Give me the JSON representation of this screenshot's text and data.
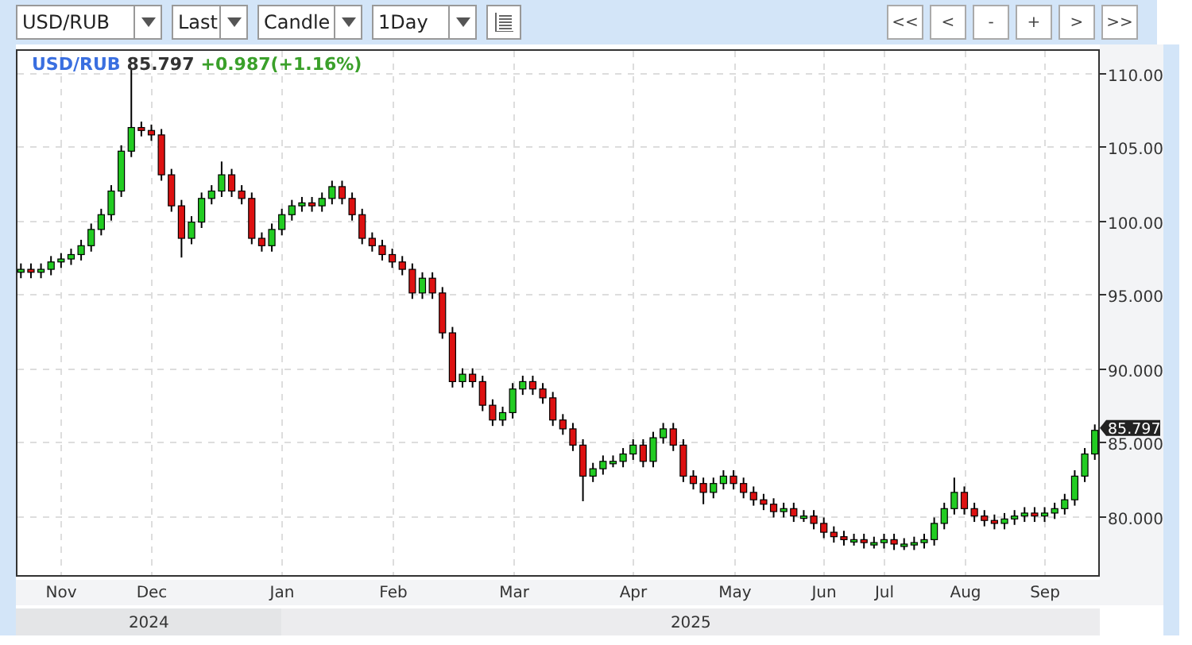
{
  "toolbar": {
    "selects": [
      {
        "value": "USD/RUB",
        "kind": "wide"
      },
      {
        "value": "Last",
        "kind": "narrow"
      },
      {
        "value": "Candle",
        "kind": "medium"
      },
      {
        "value": "1Day",
        "kind": "medium"
      }
    ],
    "nav_buttons": [
      "<<",
      "<",
      "-",
      "+",
      ">",
      ">>"
    ]
  },
  "legend": {
    "price": "85.797",
    "change": "+0.987(+1.16%)"
  },
  "chart": {
    "chart_data": {
      "type": "candlestick",
      "grid": true,
      "series": [
        {
          "name": "USD/RUB",
          "ohlc": [
            [
              96.5,
              97.1,
              96.1,
              96.7
            ],
            [
              96.7,
              97.1,
              96.1,
              96.5
            ],
            [
              96.5,
              97.1,
              96.1,
              96.7
            ],
            [
              96.7,
              97.6,
              96.3,
              97.2
            ],
            [
              97.2,
              97.8,
              96.8,
              97.4
            ],
            [
              97.4,
              98.1,
              97.0,
              97.7
            ],
            [
              97.7,
              98.7,
              97.3,
              98.3
            ],
            [
              98.3,
              99.8,
              97.9,
              99.4
            ],
            [
              99.4,
              100.8,
              99.0,
              100.4
            ],
            [
              100.4,
              102.4,
              100.0,
              102.0
            ],
            [
              102.0,
              105.1,
              101.6,
              104.7
            ],
            [
              104.7,
              110.2,
              104.3,
              106.3
            ],
            [
              106.3,
              106.7,
              105.7,
              106.1
            ],
            [
              106.1,
              106.5,
              105.4,
              105.8
            ],
            [
              105.8,
              106.2,
              102.7,
              103.1
            ],
            [
              103.1,
              103.5,
              100.6,
              101.0
            ],
            [
              101.0,
              101.4,
              97.5,
              98.8
            ],
            [
              98.8,
              100.3,
              98.4,
              99.9
            ],
            [
              99.9,
              101.9,
              99.5,
              101.5
            ],
            [
              101.5,
              102.4,
              101.1,
              102.0
            ],
            [
              102.0,
              104.0,
              101.6,
              103.1
            ],
            [
              103.1,
              103.5,
              101.6,
              102.0
            ],
            [
              102.0,
              102.4,
              101.1,
              101.5
            ],
            [
              101.5,
              101.9,
              98.4,
              98.8
            ],
            [
              98.8,
              99.2,
              97.9,
              98.3
            ],
            [
              98.3,
              99.8,
              97.9,
              99.4
            ],
            [
              99.4,
              100.8,
              99.0,
              100.4
            ],
            [
              100.4,
              101.4,
              100.0,
              101.0
            ],
            [
              101.0,
              101.6,
              100.6,
              101.2
            ],
            [
              101.2,
              101.6,
              100.6,
              101.0
            ],
            [
              101.0,
              101.9,
              100.6,
              101.5
            ],
            [
              101.5,
              102.7,
              101.1,
              102.3
            ],
            [
              102.3,
              102.7,
              101.1,
              101.5
            ],
            [
              101.5,
              101.9,
              100.0,
              100.4
            ],
            [
              100.4,
              100.8,
              98.4,
              98.8
            ],
            [
              98.8,
              99.2,
              97.9,
              98.3
            ],
            [
              98.3,
              98.7,
              97.3,
              97.7
            ],
            [
              97.7,
              98.1,
              96.8,
              97.2
            ],
            [
              97.2,
              97.6,
              96.3,
              96.7
            ],
            [
              96.7,
              97.1,
              94.7,
              95.1
            ],
            [
              95.1,
              96.5,
              94.7,
              96.1
            ],
            [
              96.1,
              96.5,
              94.7,
              95.1
            ],
            [
              95.1,
              95.5,
              92.0,
              92.4
            ],
            [
              92.4,
              92.8,
              88.7,
              89.1
            ],
            [
              89.1,
              90.0,
              88.7,
              89.6
            ],
            [
              89.6,
              90.0,
              88.7,
              89.1
            ],
            [
              89.1,
              89.5,
              87.1,
              87.5
            ],
            [
              87.5,
              87.9,
              86.1,
              86.5
            ],
            [
              86.5,
              87.4,
              86.1,
              87.0
            ],
            [
              87.0,
              89.0,
              86.6,
              88.6
            ],
            [
              88.6,
              89.5,
              88.2,
              89.1
            ],
            [
              89.1,
              89.5,
              88.2,
              88.6
            ],
            [
              88.6,
              89.0,
              87.6,
              88.0
            ],
            [
              88.0,
              88.4,
              86.1,
              86.5
            ],
            [
              86.5,
              86.9,
              85.5,
              85.9
            ],
            [
              85.9,
              86.3,
              84.4,
              84.8
            ],
            [
              84.8,
              85.2,
              81.0,
              82.7
            ],
            [
              82.7,
              83.6,
              82.3,
              83.2
            ],
            [
              83.2,
              84.1,
              82.8,
              83.7
            ],
            [
              83.7,
              84.1,
              83.3,
              83.7
            ],
            [
              83.7,
              84.6,
              83.3,
              84.2
            ],
            [
              84.2,
              85.2,
              83.8,
              84.8
            ],
            [
              84.8,
              85.2,
              83.3,
              83.7
            ],
            [
              83.7,
              85.7,
              83.3,
              85.3
            ],
            [
              85.3,
              86.3,
              84.9,
              85.9
            ],
            [
              85.9,
              86.3,
              84.4,
              84.8
            ],
            [
              84.8,
              85.2,
              82.3,
              82.7
            ],
            [
              82.7,
              83.1,
              81.8,
              82.2
            ],
            [
              82.2,
              82.6,
              80.8,
              81.6
            ],
            [
              81.6,
              82.6,
              81.2,
              82.2
            ],
            [
              82.2,
              83.1,
              81.8,
              82.7
            ],
            [
              82.7,
              83.1,
              81.8,
              82.2
            ],
            [
              82.2,
              82.6,
              81.2,
              81.6
            ],
            [
              81.6,
              82.0,
              80.7,
              81.1
            ],
            [
              81.1,
              81.5,
              80.4,
              80.8
            ],
            [
              80.8,
              81.2,
              79.9,
              80.3
            ],
            [
              80.3,
              80.9,
              79.9,
              80.5
            ],
            [
              80.5,
              80.9,
              79.6,
              80.0
            ],
            [
              80.0,
              80.4,
              79.6,
              80.0
            ],
            [
              80.0,
              80.4,
              79.1,
              79.5
            ],
            [
              79.5,
              79.9,
              78.5,
              78.9
            ],
            [
              78.9,
              79.3,
              78.2,
              78.6
            ],
            [
              78.6,
              79.0,
              78.0,
              78.4
            ],
            [
              78.4,
              78.8,
              78.0,
              78.4
            ],
            [
              78.4,
              78.8,
              77.8,
              78.2
            ],
            [
              78.2,
              78.6,
              77.8,
              78.2
            ],
            [
              78.2,
              78.8,
              77.8,
              78.4
            ],
            [
              78.4,
              78.8,
              77.7,
              78.1
            ],
            [
              78.1,
              78.5,
              77.7,
              78.1
            ],
            [
              78.1,
              78.6,
              77.7,
              78.2
            ],
            [
              78.2,
              78.8,
              77.8,
              78.4
            ],
            [
              78.4,
              79.9,
              78.0,
              79.5
            ],
            [
              79.5,
              80.9,
              79.1,
              80.5
            ],
            [
              80.5,
              82.6,
              80.1,
              81.6
            ],
            [
              81.6,
              82.0,
              80.1,
              80.5
            ],
            [
              80.5,
              80.9,
              79.6,
              80.0
            ],
            [
              80.0,
              80.4,
              79.3,
              79.7
            ],
            [
              79.7,
              80.1,
              79.1,
              79.5
            ],
            [
              79.5,
              80.2,
              79.1,
              79.8
            ],
            [
              79.8,
              80.4,
              79.4,
              80.0
            ],
            [
              80.0,
              80.6,
              79.6,
              80.2
            ],
            [
              80.2,
              80.6,
              79.6,
              80.0
            ],
            [
              80.0,
              80.6,
              79.6,
              80.2
            ],
            [
              80.2,
              80.9,
              79.8,
              80.5
            ],
            [
              80.5,
              81.5,
              80.1,
              81.1
            ],
            [
              81.1,
              83.1,
              80.7,
              82.7
            ],
            [
              82.7,
              84.6,
              82.3,
              84.2
            ],
            [
              84.2,
              86.2,
              83.8,
              85.8
            ]
          ]
        }
      ],
      "categories": [
        null,
        null,
        null,
        null,
        "Nov",
        null,
        null,
        null,
        null,
        null,
        null,
        null,
        null,
        "Dec",
        null,
        null,
        null,
        null,
        null,
        null,
        null,
        null,
        null,
        null,
        null,
        null,
        "Jan",
        null,
        null,
        null,
        null,
        null,
        null,
        null,
        null,
        null,
        null,
        "Feb",
        null,
        null,
        null,
        null,
        null,
        null,
        null,
        null,
        null,
        null,
        null,
        "Mar",
        null,
        null,
        null,
        null,
        null,
        null,
        null,
        null,
        null,
        null,
        null,
        "Apr",
        null,
        null,
        null,
        null,
        null,
        null,
        null,
        null,
        null,
        "May",
        null,
        null,
        null,
        null,
        null,
        null,
        null,
        null,
        "Jun",
        null,
        null,
        null,
        null,
        null,
        "Jul",
        null,
        null,
        null,
        null,
        null,
        null,
        null,
        "Aug",
        null,
        null,
        null,
        null,
        null,
        null,
        null,
        "Sep",
        null,
        null,
        null,
        null,
        null
      ],
      "ylim": [
        76,
        111.6
      ],
      "yticks": [
        {
          "value": 110,
          "label": "110.00"
        },
        {
          "value": 105,
          "label": "105.00"
        },
        {
          "value": 100,
          "label": "100.00"
        },
        {
          "value": 95,
          "label": "95.000"
        },
        {
          "value": 90,
          "label": "90.000"
        },
        {
          "value": 85,
          "label": "85.000"
        },
        {
          "value": 80,
          "label": "80.000"
        }
      ],
      "annotations": [
        "85.797"
      ]
    },
    "years": [
      "2024",
      "2025"
    ]
  }
}
